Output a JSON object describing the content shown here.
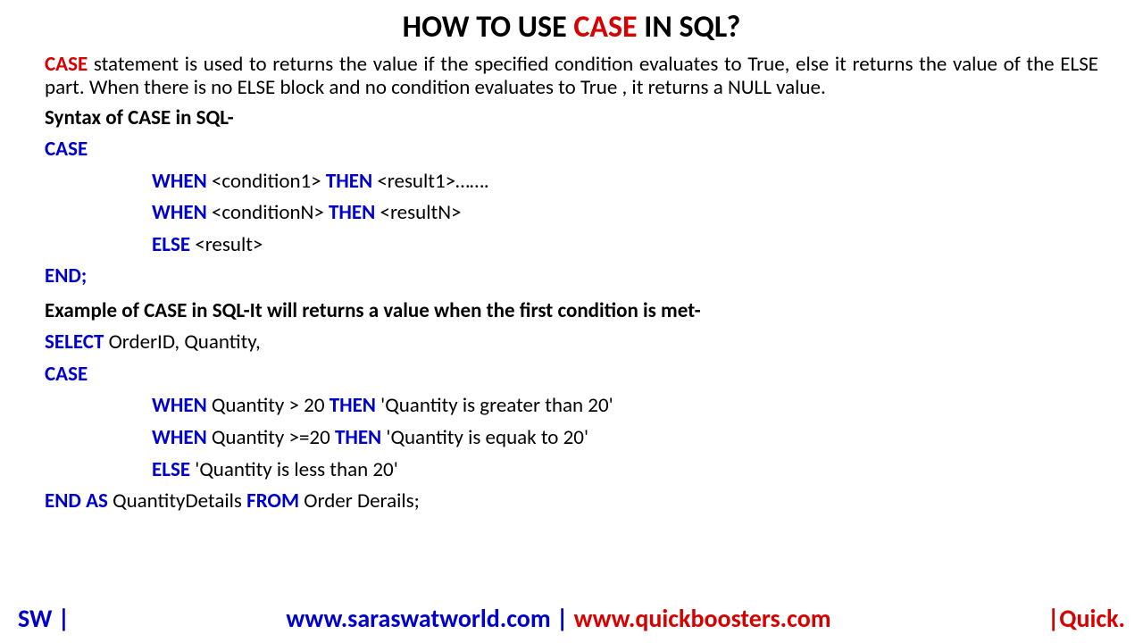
{
  "title": {
    "pre": "HOW TO USE ",
    "kw": "CASE",
    "post": " IN SQL?"
  },
  "desc": {
    "kw": "CASE",
    "text": " statement is used to returns the value if the specified condition evaluates to True, else it returns the  value of the ELSE part. When there is no ELSE block and no condition evaluates to True , it returns a NULL value."
  },
  "syntaxHeading": "Syntax of CASE in SQL-",
  "syntax": {
    "case": "CASE",
    "when1_kw1": "WHEN",
    "when1_cond": " <condition1> ",
    "when1_kw2": "THEN",
    "when1_res": " <result1>…….",
    "when2_kw1": "WHEN",
    "when2_cond": " <conditionN> ",
    "when2_kw2": "THEN",
    "when2_res": " <resultN>",
    "else_kw": "ELSE",
    "else_res": " <result>",
    "end": "END;"
  },
  "exampleHeading": "Example of CASE in SQL-It will returns a value when the first condition is met-",
  "example": {
    "select_kw": "SELECT",
    "select_cols": " OrderID, Quantity,",
    "case": "CASE",
    "w1_kw1": "WHEN",
    "w1_cond": " Quantity > 20 ",
    "w1_kw2": "THEN",
    "w1_res": "  'Quantity is greater than 20'",
    "w2_kw1": "WHEN",
    "w2_cond": " Quantity >=20 ",
    "w2_kw2": "THEN",
    "w2_res": "  'Quantity is equak to 20'",
    "else_kw": "ELSE",
    "else_res": " 'Quantity is less than 20'",
    "end_kw": "END AS",
    "end_col": " QuantityDetails ",
    "from_kw": "FROM",
    "from_tbl": " Order Derails;"
  },
  "footer": {
    "left": "SW |",
    "url1": "www.saraswatworld.com",
    "sep": " | ",
    "url2": "www.quickboosters.com",
    "right": "|Quick."
  }
}
